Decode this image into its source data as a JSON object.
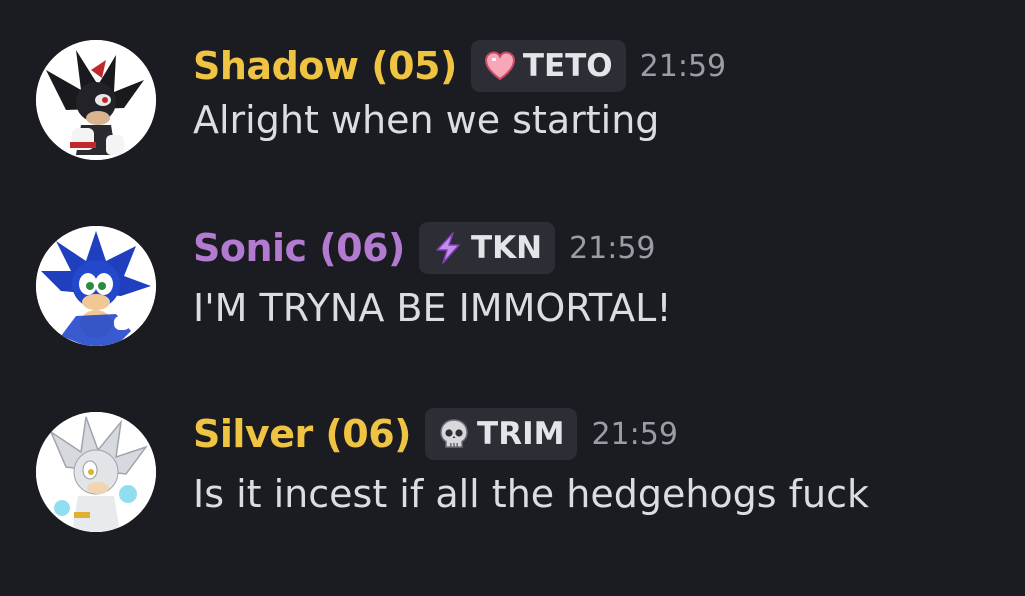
{
  "colors": {
    "background": "#1b1b22",
    "tag_background": "#2c2d35",
    "timestamp": "#9a9ca6",
    "message_text": "#dcdde1"
  },
  "messages": [
    {
      "author": "Shadow (05)",
      "author_color": "#f0c443",
      "avatar_icon": "shadow-hedgehog-avatar",
      "tag_icon": "pink-heart-icon",
      "tag": "TETO",
      "time": "21:59",
      "text": "Alright when we starting"
    },
    {
      "author": "Sonic (06)",
      "author_color": "#b27bd0",
      "avatar_icon": "sonic-hedgehog-avatar",
      "tag_icon": "lightning-bolt-icon",
      "tag": "TKN",
      "time": "21:59",
      "text": "I'M TRYNA BE IMMORTAL!"
    },
    {
      "author": "Silver (06)",
      "author_color": "#f0c443",
      "avatar_icon": "silver-hedgehog-avatar",
      "tag_icon": "skull-icon",
      "tag": "TRIM",
      "time": "21:59",
      "text": "Is it incest if all the hedgehogs fuck"
    }
  ]
}
